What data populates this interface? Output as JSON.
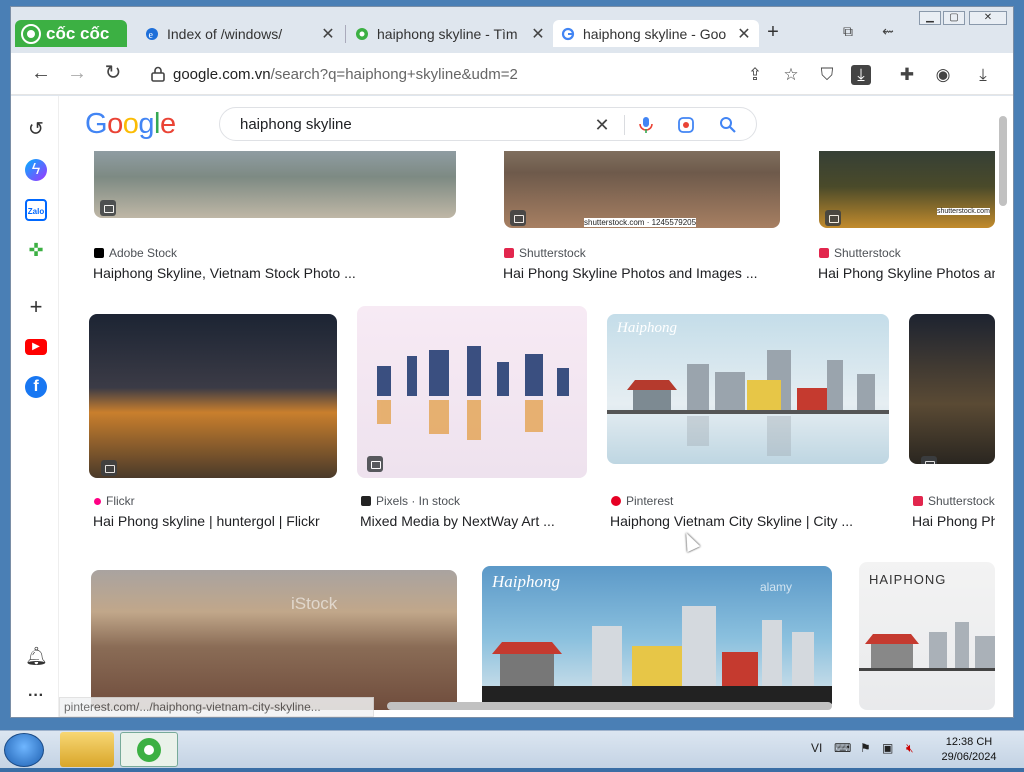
{
  "browser": {
    "brand": "cốc cốc",
    "tabs": [
      {
        "title": "Index of /windows/",
        "favicon": "ie-icon"
      },
      {
        "title": "haiphong skyline - Tìm",
        "favicon": "coccoc-icon"
      },
      {
        "title": "haiphong skyline - Goo",
        "favicon": "google-g-icon",
        "active": true
      }
    ],
    "url_host": "google.com.vn",
    "url_path": "/search?q=haiphong+skyline&udm=2"
  },
  "google": {
    "logo": "Google",
    "query": "haiphong skyline"
  },
  "results": {
    "row1": [
      {
        "source": "Adobe Stock",
        "title": "Haiphong Skyline, Vietnam Stock Photo ...",
        "src_color": "#000000"
      },
      {
        "source": "Shutterstock",
        "title": "Hai Phong Skyline Photos and Images ...",
        "src_color": "#e2264d",
        "watermark": "shutterstock.com · 1245579205"
      },
      {
        "source": "Shutterstock",
        "title": "Hai Phong Skyline Photos and",
        "src_color": "#e2264d",
        "watermark": "shutterstock.com"
      }
    ],
    "row2": [
      {
        "source": "Flickr",
        "title": "Hai Phong skyline | huntergol | Flickr",
        "src_color": "#ff0084"
      },
      {
        "source": "Pixels · In stock",
        "title": "Mixed Media by NextWay Art ...",
        "src_color": "#222222"
      },
      {
        "source": "Pinterest",
        "title": "Haiphong Vietnam City Skyline | City ...",
        "src_color": "#e60023",
        "caption": "Haiphong"
      },
      {
        "source": "Shutterstock",
        "title": "Hai Phong Pho",
        "src_color": "#e2264d"
      }
    ],
    "row3": [
      {
        "watermark": "iStock"
      },
      {
        "caption": "Haiphong",
        "watermark": "alamy"
      },
      {
        "caption": "HAIPHONG"
      }
    ]
  },
  "status_url": "pinterest.com/.../haiphong-vietnam-city-skyline...",
  "taskbar": {
    "lang": "VI",
    "time": "12:38 CH",
    "date": "29/06/2024"
  }
}
